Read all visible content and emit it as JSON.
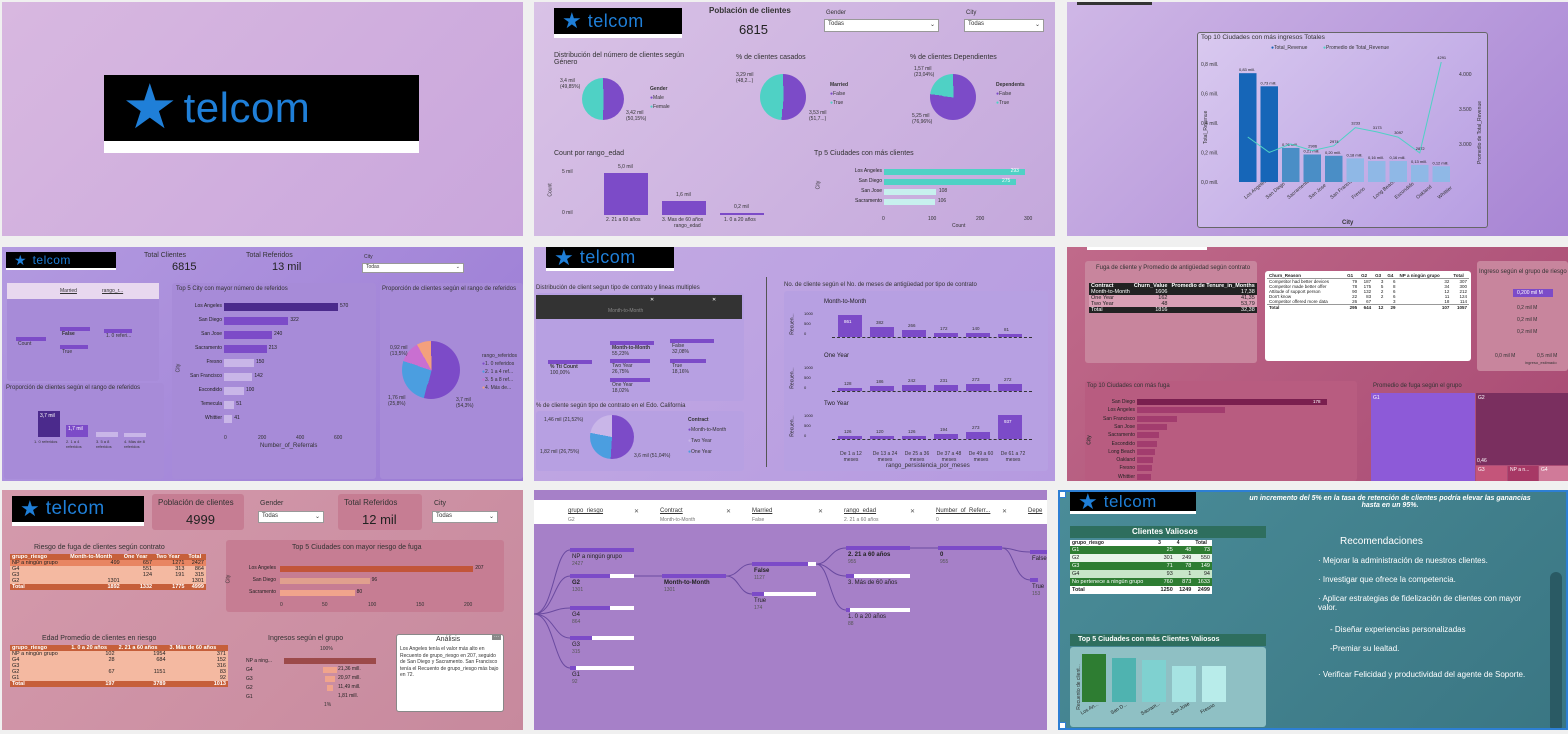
{
  "brand": {
    "name": "telcom"
  },
  "panel2": {
    "poblacion_label": "Población de clientes",
    "poblacion_value": "6815",
    "gender_label": "Gender",
    "gender_value": "Todas",
    "city_label": "City",
    "city_value": "Todas",
    "dist_title": "Distribución del número de clientes según Género",
    "dist_legend_title": "Gender",
    "dist_legend": [
      "Male",
      "Female"
    ],
    "dist_labels": [
      "3,4 mil (49,85%)",
      "3,42 mil (50,15%)"
    ],
    "casados_title": "% de clientes casados",
    "casados_legend_title": "Married",
    "casados_legend": [
      "False",
      "True"
    ],
    "casados_labels": [
      "3,29 mil (48,2...)",
      "3,53 mil (51,7...)"
    ],
    "dep_title": "% de clientes Dependientes",
    "dep_legend_title": "Dependents",
    "dep_legend": [
      "False",
      "True"
    ],
    "dep_labels": [
      "1,57 mil (23,04%)",
      "5,25 mil (76,96%)"
    ],
    "edad_title": "Count por rango_edad",
    "edad_axis_y": "Count",
    "edad_axis_x": "rango_edad",
    "edad_ticks": [
      "5 mil",
      "0 mil"
    ],
    "edad_cats": [
      "2. 21 a 60 años",
      "3. Mas de 60 años",
      "1. 0 a 20 años"
    ],
    "edad_vals": [
      "5,0 mil",
      "1,6 mil",
      "0,2 mil"
    ],
    "top5_title": "Tp 5 Ciudades con más clientes",
    "top5_axis_y": "City",
    "top5_axis_x": "Count",
    "top5_ticks": [
      "0",
      "100",
      "200",
      "300"
    ]
  },
  "panel3": {
    "title": "Top 10 Ciudades con más ingresos Totales",
    "legend": [
      "Total_Revenue",
      "Promedio de Total_Revenue"
    ],
    "axis_y": "Total_Revenue",
    "axis_y2": "Promedio de Total_Revenue",
    "axis_x": "City",
    "y_ticks": [
      "0,8 mill.",
      "0,6 mill.",
      "0,4 mill.",
      "0,2 mill.",
      "0,0 mill."
    ],
    "y2_ticks": [
      "4.000",
      "3.500",
      "3.000"
    ],
    "bar_labels": [
      "0,83 mill.",
      "0,73 mill.",
      "0,26 mill.",
      "0,21 mill.",
      "0,20 mill.",
      "0,18 mill.",
      "0,16 mill.",
      "0,16 mill.",
      "0,13 mill.",
      "0,12 mill."
    ],
    "line_labels": [
      "4291",
      "2906",
      "2974",
      "3233",
      "3173",
      "3097",
      "2872"
    ],
    "cities": [
      "Los Angeles",
      "San Diego",
      "Sacramento",
      "San Jose",
      "San Francisco",
      "Fresno",
      "Long Beach",
      "Escondido",
      "Oakland",
      "Whittier"
    ]
  },
  "panel4": {
    "total_clientes_label": "Total Clientes",
    "total_clientes_value": "6815",
    "total_ref_label": "Total Referidos",
    "total_ref_value": "13 mil",
    "city_label": "City",
    "city_value": "Todas",
    "tree_headers": [
      "Married",
      "rango_r..."
    ],
    "tree_nodes": [
      "Count",
      "False",
      "True",
      "1. 0 referi..."
    ],
    "prop_title": "Proporción de clientes según el rango de referidos",
    "prop_axis_y": "Recuento de...",
    "prop_vals": [
      "3,7 mil",
      "1,7 mil"
    ],
    "prop_cats": [
      "1. 0 referidos",
      "2. 1 a 4 referidos",
      "3. 5 a 8 referidos",
      "4. Más de 8 referidos"
    ],
    "top5_title": "Top 5 City con mayor número de referidos",
    "top5_axis_y": "City",
    "top5_axis_x": "Number_of_Referrals",
    "top5_ticks": [
      "0",
      "200",
      "400",
      "600"
    ],
    "top5_cities": [
      "Los Angeles",
      "San Diego",
      "San Jose",
      "Sacramento",
      "Fresno",
      "San Francisco",
      "Escondido",
      "Temecula",
      "Whittier"
    ],
    "top5_vals": [
      "570",
      "322",
      "240",
      "213",
      "150",
      "142",
      "100",
      "51",
      "41"
    ],
    "donut_title": "Proporción de clientes según el rango de referidos",
    "donut_legend_title": "rango_referidos",
    "donut_legend": [
      "1. 0 referidos",
      "2. 1 a 4 ref...",
      "3. 5 a 8 ref...",
      "4. Más de..."
    ],
    "donut_labels": [
      "0,92 mil (13,5%)",
      "1,76 mil (25,8%)",
      "3,7 mil (54,3%)"
    ]
  },
  "panel5": {
    "dist_title": "Distribución de client segun tipo de contrato y lineas multiples",
    "tree_nodes": [
      "% Tti Count",
      "Month-to-Month",
      "Two Year",
      "One Year",
      "False",
      "True"
    ],
    "tree_values": [
      "100,00%",
      "55,23%",
      "26,75%",
      "18,02%",
      "32,08%",
      "18,16%"
    ],
    "col_titles": [
      "Month-to-Month"
    ],
    "months_title": "No. de cliente según el No. de meses de antigüedad por tipo de contrato",
    "months_axis_y": "Recuen...",
    "months_axis_x": "rango_persistencia_por_meses",
    "ticks": [
      "1000",
      "500",
      "0"
    ],
    "cats": [
      "De 1 a 12 meses",
      "De 13 a 24 meses",
      "De 25 a 36 meses",
      "De 37 a 48 meses",
      "De 49 a 60 meses",
      "De 61 a 72 meses"
    ],
    "mtm_label": "Month-to-Month",
    "mtm_vals": [
      "861",
      "382",
      "266",
      "172",
      "140",
      "81"
    ],
    "one_label": "One Year",
    "one_vals": [
      "128",
      "186",
      "242",
      "231",
      "273",
      "272"
    ],
    "two_label": "Two Year",
    "two_vals": [
      "126",
      "120",
      "126",
      "194",
      "273",
      "937"
    ],
    "cal_title": "% de cliente según tipo de contrato en el Edo. California",
    "cal_legend_title": "Contract",
    "cal_legend": [
      "Month-to-Month",
      "Two Year",
      "One Year"
    ],
    "cal_labels": [
      "1,46 mil (21,52%)",
      "1,82 mil (26,75%)",
      "3,6 mil (51,04%)"
    ]
  },
  "panel6": {
    "fuga_title": "Fuga de cliente y Promedio de antigüedad según contrato",
    "fuga_headers": [
      "Contract",
      "Churn_Value",
      "Promedio de Tenure_in_Months"
    ],
    "fuga_rows": [
      [
        "Month-to-Month",
        "1606",
        "17,38"
      ],
      [
        "One Year",
        "162",
        "41,35"
      ],
      [
        "Two Year",
        "48",
        "53,79"
      ],
      [
        "Total",
        "1816",
        "32,38"
      ]
    ],
    "churn_headers": [
      "Churn_Reason",
      "G1",
      "G2",
      "G3",
      "G4",
      "NP a ningún grupo",
      "Total"
    ],
    "churn_rows": [
      [
        "Competitor had better devices",
        "79",
        "187",
        "3",
        "6",
        "32",
        "307"
      ],
      [
        "Competitor made better offer",
        "78",
        "175",
        "5",
        "8",
        "34",
        "300"
      ],
      [
        "Attitude of support person",
        "90",
        "132",
        "2",
        "6",
        "12",
        "212"
      ],
      [
        "Don't know",
        "22",
        "83",
        "2",
        "6",
        "11",
        "124"
      ],
      [
        "Competitor offered more data",
        "26",
        "67",
        "",
        "3",
        "18",
        "114"
      ],
      [
        "Total",
        "295",
        "644",
        "12",
        "29",
        "107",
        "1057"
      ]
    ],
    "ingreso_title": "Ingreso según el grupo de riesgo",
    "ingreso_vals": [
      "0,200 mil M",
      "0,2 mil M",
      "0,2 mil M",
      "0,2 mil M"
    ],
    "ingreso_axis": [
      "0,0 mil M",
      "0,5 mil M"
    ],
    "ingreso_axis_label": "ingreso_estimado",
    "top10_title": "Top 10 Ciudades con más fuga",
    "top10_axis": "City",
    "top10_cities": [
      "San Diego",
      "Los Angeles",
      "San Francisco",
      "San Jose",
      "Sacramento",
      "Escondido",
      "Long Beach",
      "Oakland",
      "Fresno",
      "Whittier"
    ],
    "top10_vals": [
      "178",
      "",
      "",
      "",
      "",
      "",
      "",
      "",
      "",
      ""
    ],
    "tree_title": "Promedio de fuga según el grupo",
    "tree_labels": [
      "G1",
      "G2",
      "G3",
      "NP a n...",
      "G4"
    ],
    "tree_value": "0,46"
  },
  "panel7": {
    "poblacion_label": "Población de clientes",
    "poblacion_value": "4999",
    "gender_label": "Gender",
    "gender_value": "Todas",
    "total_ref_label": "Total Referidos",
    "total_ref_value": "12 mil",
    "city_label": "City",
    "city_value": "Todas",
    "riesgo_title": "Riesgo de fuga de clientes según contrato",
    "riesgo_headers": [
      "grupo_riesgo",
      "Month-to-Month",
      "One Year",
      "Two Year",
      "Total"
    ],
    "riesgo_rows": [
      [
        "NP a ningún grupo",
        "499",
        "657",
        "1271",
        "2427"
      ],
      [
        "G4",
        "",
        "551",
        "313",
        "864"
      ],
      [
        "G3",
        "",
        "124",
        "191",
        "315"
      ],
      [
        "G2",
        "1301",
        "",
        "",
        "1301"
      ],
      [
        "Total",
        "1892",
        "1332",
        "1775",
        "4999"
      ]
    ],
    "top5_title": "Top 5 Ciudades con mayor riesgo de fuga",
    "top5_axis_y": "City",
    "top5_cities": [
      "Los Angeles",
      "San Diego",
      "Sacramento"
    ],
    "top5_vals": [
      "207",
      "96",
      "80"
    ],
    "top5_ticks": [
      "0",
      "50",
      "100",
      "150",
      "200"
    ],
    "edad_title": "Edad Promedio de clientes en riesgo",
    "edad_headers": [
      "grupo_riesgo",
      "1. 0 a 20 años",
      "2. 21 a 60 años",
      "3. Más de 60 años"
    ],
    "edad_rows": [
      [
        "NP a ningún grupo",
        "102",
        "1954",
        "371"
      ],
      [
        "G4",
        "28",
        "684",
        "152"
      ],
      [
        "G3",
        "",
        "",
        "316"
      ],
      [
        "G2",
        "67",
        "1151",
        "83"
      ],
      [
        "G1",
        "",
        "",
        "92"
      ],
      [
        "Total",
        "197",
        "3789",
        "1013"
      ]
    ],
    "ingresos_title": "Ingresos según el grupo",
    "ingresos_pct_top": "100%",
    "ingresos_pct_bot": "1%",
    "ingresos_cats": [
      "NP a ning...",
      "G4",
      "G3",
      "G2",
      "G1"
    ],
    "ingresos_vals": [
      "21,36 mill.",
      "20,97 mill.",
      "11,49 mill.",
      "1,81 mill."
    ],
    "analisis_title": "Análisis",
    "analisis_text": "Los Angeles tenía el valor más alto en Recuento de grupo_riesgo en 207, seguido de San Diego y Sacramento. San Francisco tenía el Recuento de grupo_riesgo más bajo en 72."
  },
  "panel8": {
    "filters": [
      {
        "label": "grupo_riesgo",
        "value": "G2"
      },
      {
        "label": "Contract",
        "value": "Month-to-Month"
      },
      {
        "label": "Married",
        "value": "False"
      },
      {
        "label": "rango_edad",
        "value": "2. 21 a 60 años"
      },
      {
        "label": "Number_of_Referr...",
        "value": "0"
      },
      {
        "label": "Depe",
        "value": ""
      }
    ],
    "nodes_l": [
      "NP a ningún grupo",
      "G2",
      "G4",
      "G3",
      "G1"
    ],
    "nodes_l_vals": [
      "2427",
      "1301",
      "864",
      "315",
      "92"
    ],
    "node_m": "Month-to-Month",
    "node_m_val": "1301",
    "nodes_m2": [
      "False",
      "True"
    ],
    "nodes_m2_vals": [
      "1127",
      "174"
    ],
    "nodes_r": [
      "2. 21 a 60 años",
      "3. Más de 60 años",
      "1. 0 a 20 años"
    ],
    "nodes_r_vals": [
      "955",
      "",
      "88"
    ],
    "node_r2": "0",
    "node_r2_val": "955",
    "nodes_far": [
      "False",
      "True"
    ],
    "nodes_far_vals": [
      "",
      "153"
    ]
  },
  "panel9": {
    "banner": "un incremento del 5% en la tasa de retención de clientes podría elevar las ganancias hasta en un 95%.",
    "valiosos_title": "Clientes Valiosos",
    "valiosos_headers": [
      "grupo_riesgo",
      "3",
      "4",
      "Total"
    ],
    "valiosos_rows": [
      [
        "G1",
        "25",
        "48",
        "73"
      ],
      [
        "G2",
        "301",
        "249",
        "550"
      ],
      [
        "G3",
        "71",
        "78",
        "149"
      ],
      [
        "G4",
        "93",
        "1",
        "94"
      ],
      [
        "No pertenece a ningún grupo",
        "760",
        "873",
        "1633"
      ],
      [
        "Total",
        "1250",
        "1249",
        "2499"
      ]
    ],
    "top5_title": "Top 5 Ciudades con más Clientes Valiosos",
    "top5_axis_y": "Recuento de client...",
    "top5_cities": [
      "Los An...",
      "San D...",
      "Sacram...",
      "San Jose",
      "Fresno"
    ],
    "top5_vals": [
      100,
      92,
      88,
      74,
      74
    ],
    "rec_title": "Recomendaciones",
    "rec_items": [
      "· Mejorar la administración de nuestros clientes.",
      "· Investigar que ofrece la competencia.",
      "· Aplicar estrategias de fidelización de clientes con mayor valor.",
      "- Diseñar experiencias personalizadas",
      "-Premiar su lealtad.",
      "· Verificar Felicidad y productividad del agente de Soporte."
    ]
  },
  "chart_data": [
    {
      "type": "bar",
      "title": "Count por rango_edad",
      "categories": [
        "2. 21 a 60 años",
        "3. Mas de 60 años",
        "1. 0 a 20 años"
      ],
      "values": [
        5000,
        1600,
        200
      ],
      "xlabel": "rango_edad",
      "ylabel": "Count"
    },
    {
      "type": "bar",
      "title": "Tp 5 Ciudades con más clientes",
      "categories": [
        "Los Angeles",
        "San Diego",
        "San Jose",
        "Sacramento"
      ],
      "values": [
        293,
        275,
        108,
        106
      ],
      "xlabel": "Count",
      "ylabel": "City"
    },
    {
      "type": "bar",
      "title": "Top 10 Ciudades con más ingresos Totales",
      "categories": [
        "Los Angeles",
        "San Diego",
        "Sacramento",
        "San Jose",
        "San Francisco",
        "Fresno",
        "Long Beach",
        "Escondido",
        "Oakland",
        "Whittier"
      ],
      "series": [
        {
          "name": "Total_Revenue",
          "values": [
            0.83,
            0.73,
            0.26,
            0.21,
            0.2,
            0.18,
            0.16,
            0.16,
            0.13,
            0.12
          ]
        },
        {
          "name": "Promedio de Total_Revenue",
          "values": [
            3100,
            2880,
            3000,
            2906,
            2974,
            3233,
            3173,
            3097,
            2872,
            4291
          ]
        }
      ],
      "xlabel": "City",
      "ylabel": "Total_Revenue"
    }
  ]
}
